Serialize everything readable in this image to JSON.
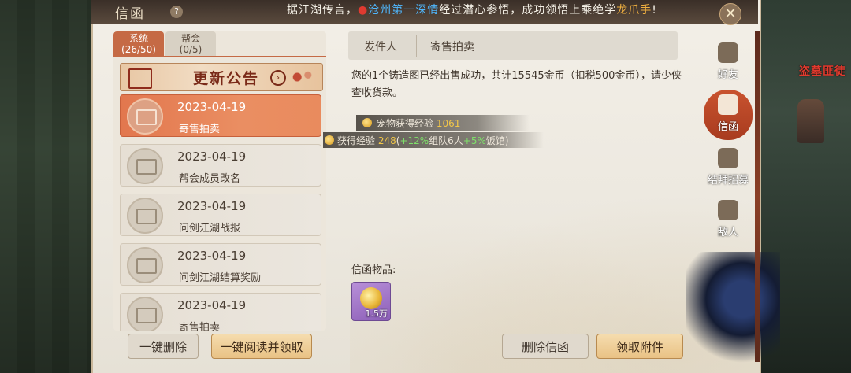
{
  "window": {
    "title": "信函",
    "marquee_prefix": "据江湖传言，",
    "marquee_highlight": "沧州第一深情",
    "marquee_mid": "经过潜心参悟，成功领悟上乘绝学",
    "marquee_skill": "龙爪手",
    "marquee_end": "!"
  },
  "world": {
    "label_right": "盗墓匪徒"
  },
  "tabs": [
    {
      "label": "系统",
      "count": "(26/50)"
    },
    {
      "label": "帮会",
      "count": "(0/5)"
    }
  ],
  "banner": {
    "text": "更新公告"
  },
  "mail_list": [
    {
      "date": "2023-04-19",
      "subject": "寄售拍卖"
    },
    {
      "date": "2023-04-19",
      "subject": "帮会成员改名"
    },
    {
      "date": "2023-04-19",
      "subject": "问剑江湖战报"
    },
    {
      "date": "2023-04-19",
      "subject": "问剑江湖结算奖励"
    },
    {
      "date": "2023-04-19",
      "subject": "寄售拍卖"
    }
  ],
  "detail": {
    "sender_label": "发件人",
    "sender_value": "寄售拍卖",
    "body": "您的1个铸造图已经出售成功，共计15545金币（扣税500金币），请少侠查收货款。",
    "items_label": "信函物品:",
    "item_qty": "1.5万"
  },
  "exp": {
    "pet_label": "宠物获得经验",
    "pet_value": "1061",
    "gain_label": "获得经验",
    "gain_value": "248",
    "bonus_1": "+12%",
    "bonus_1_label": "组队6人",
    "bonus_2": "+5%",
    "bonus_2_label": "饭馆"
  },
  "buttons": {
    "delete_all": "一键删除",
    "read_all": "一键阅读并领取",
    "delete_mail": "删除信函",
    "claim": "领取附件"
  },
  "sidenav": [
    {
      "label": "好友",
      "icon": "friends-icon"
    },
    {
      "label": "信函",
      "icon": "mail-icon"
    },
    {
      "label": "结拜招募",
      "icon": "sworn-recruit-icon"
    },
    {
      "label": "敌人",
      "icon": "enemy-icon"
    }
  ],
  "colors": {
    "accent": "#c56a45",
    "selected_mail": "#e2774e",
    "exp_yellow": "#f2c748",
    "exp_green": "#7fe06a"
  }
}
